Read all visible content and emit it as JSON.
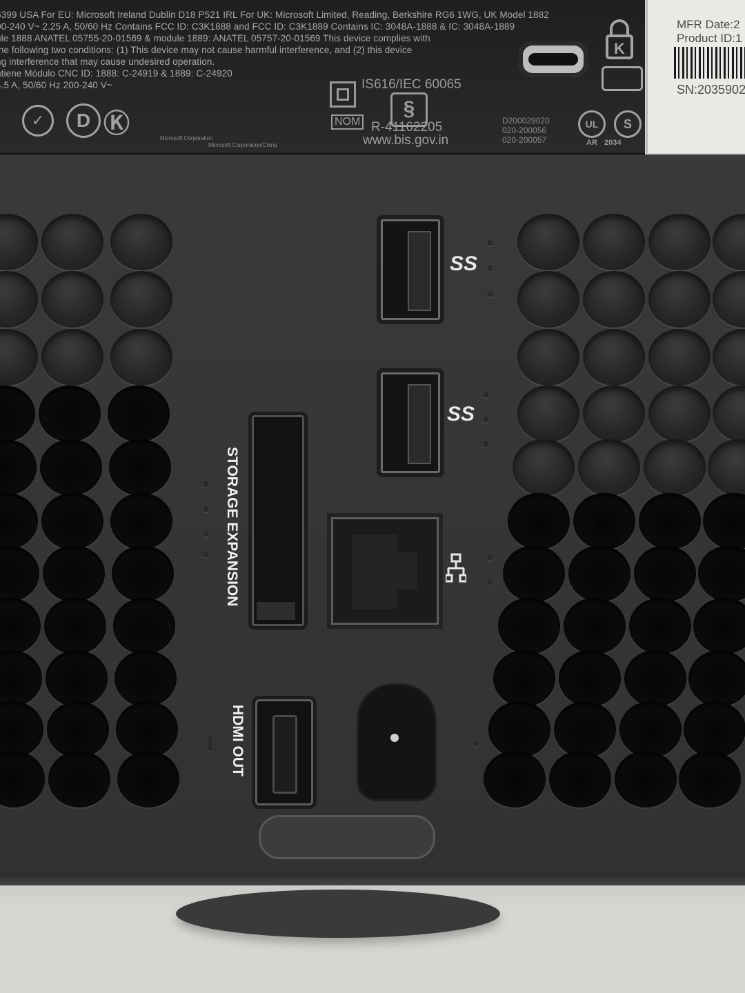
{
  "label": {
    "lines": [
      "6399 USA  For EU: Microsoft Ireland Dublin D18 P521 IRL  For UK: Microsoft Limited, Reading, Berkshire RG6 1WG, UK  Model 1882",
      "00-240 V~ 2.25 A, 50/60 Hz   Contains FCC ID: C3K1888 and FCC ID: C3K1889  Contains IC: 3048A-1888 & IC: 3048A-1889",
      "ule 1888 ANATEL 05755-20-01569 & module 1889: ANATEL 05757-20-01569   This device complies with",
      "the following two conditions: (1) This device may not cause harmful interference, and (2) this device",
      "ng interference that may cause undesired operation.",
      "ntiene Módulo CNC ID: 1888: C-24919 & 1889: C-24920",
      "4.5 A, 50/60 Hz   200-240 V~"
    ],
    "small_text": [
      "Microsoft Corporation",
      "Microsoft Corporation/China"
    ],
    "standard": "IS616/IEC 60065",
    "nom": "NOM",
    "r_number": "R-41162205",
    "website": "www.bis.gov.in",
    "codes": [
      "D200029020",
      "020-200056",
      "020-200057"
    ],
    "ul_mark": "UL",
    "ul_sub": "AR",
    "ul_number": "2034",
    "cert_marks": [
      "D",
      "S"
    ]
  },
  "sticker": {
    "mfr_date": "MFR Date:2",
    "product_id": "Product ID:1",
    "serial": "SN:2035902"
  },
  "ports": {
    "storage_label": "STORAGE EXPANSION",
    "hdmi_label": "HDMI OUT",
    "usb_symbol": "SS",
    "ethernet_symbol": "network-icon"
  }
}
